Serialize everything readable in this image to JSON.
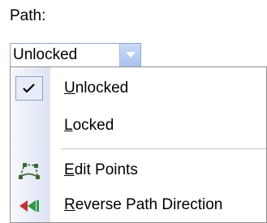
{
  "path_label": "Path:",
  "combo": {
    "value": "Unlocked"
  },
  "menu": {
    "items": [
      {
        "label_underlined": "U",
        "label_rest": "nlocked",
        "checked": true
      },
      {
        "label_underlined": "L",
        "label_rest": "ocked",
        "checked": false
      },
      {
        "label_underlined": "E",
        "label_rest": "dit Points",
        "icon": "edit-points-icon"
      },
      {
        "label_underlined": "R",
        "label_rest": "everse Path Direction",
        "icon": "reverse-path-icon"
      }
    ]
  },
  "colors": {
    "combo_border": "#8aa8d6",
    "dropdown_button": "#b7cdf3",
    "edit_icon": "#3a6a2a",
    "reverse_icon_green": "#2e9a4a",
    "reverse_icon_red": "#c8322d"
  }
}
